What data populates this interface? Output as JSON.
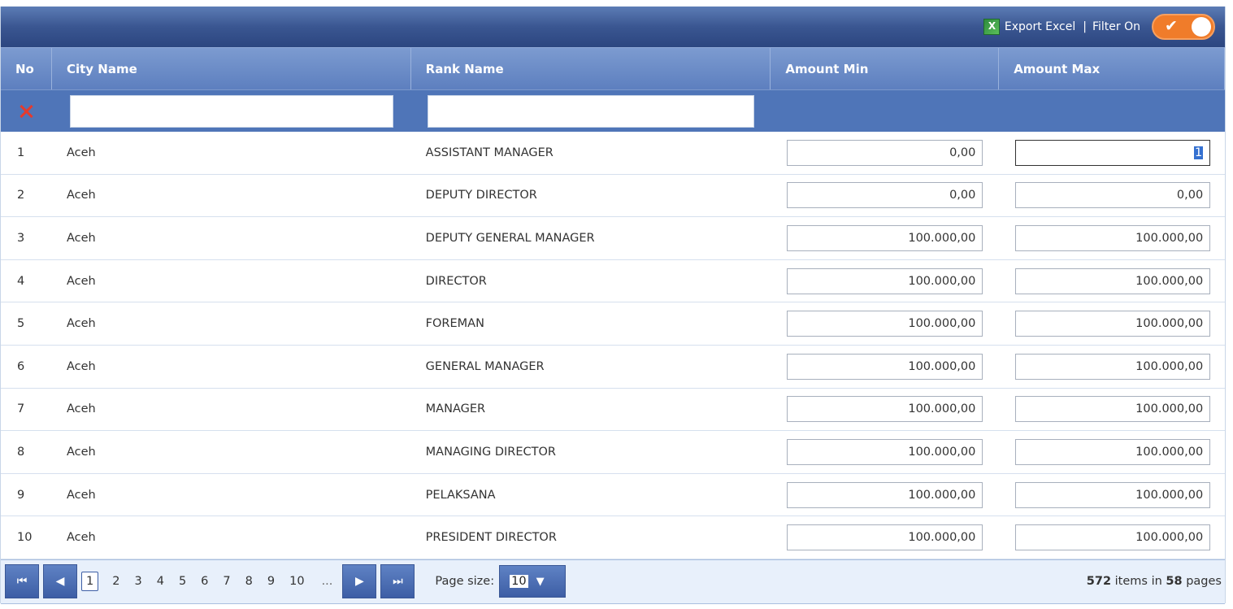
{
  "toolbar": {
    "export_label": "Export Excel",
    "separator": "|",
    "filter_label": "Filter On",
    "filter_on": true,
    "toggle_color": "#f07c2a"
  },
  "columns": [
    "No",
    "City Name",
    "Rank Name",
    "Amount Min",
    "Amount Max"
  ],
  "filters": {
    "city_value": "",
    "rank_value": ""
  },
  "rows": [
    {
      "no": "1",
      "city": "Aceh",
      "rank": "ASSISTANT MANAGER",
      "min": "0,00",
      "max": "1"
    },
    {
      "no": "2",
      "city": "Aceh",
      "rank": "DEPUTY DIRECTOR",
      "min": "0,00",
      "max": "0,00"
    },
    {
      "no": "3",
      "city": "Aceh",
      "rank": "DEPUTY GENERAL MANAGER",
      "min": "100.000,00",
      "max": "100.000,00"
    },
    {
      "no": "4",
      "city": "Aceh",
      "rank": "DIRECTOR",
      "min": "100.000,00",
      "max": "100.000,00"
    },
    {
      "no": "5",
      "city": "Aceh",
      "rank": "FOREMAN",
      "min": "100.000,00",
      "max": "100.000,00"
    },
    {
      "no": "6",
      "city": "Aceh",
      "rank": "GENERAL MANAGER",
      "min": "100.000,00",
      "max": "100.000,00"
    },
    {
      "no": "7",
      "city": "Aceh",
      "rank": "MANAGER",
      "min": "100.000,00",
      "max": "100.000,00"
    },
    {
      "no": "8",
      "city": "Aceh",
      "rank": "MANAGING DIRECTOR",
      "min": "100.000,00",
      "max": "100.000,00"
    },
    {
      "no": "9",
      "city": "Aceh",
      "rank": "PELAKSANA",
      "min": "100.000,00",
      "max": "100.000,00"
    },
    {
      "no": "10",
      "city": "Aceh",
      "rank": "PRESIDENT DIRECTOR",
      "min": "100.000,00",
      "max": "100.000,00"
    }
  ],
  "pager": {
    "pages": [
      "1",
      "2",
      "3",
      "4",
      "5",
      "6",
      "7",
      "8",
      "9",
      "10"
    ],
    "current": "1",
    "ellipsis": "...",
    "page_size_label": "Page size:",
    "page_size": "10",
    "total_items": "572",
    "items_text": "items in",
    "total_pages": "58",
    "pages_text": "pages"
  },
  "colors": {
    "header": "#5d7fbf",
    "toolbar": "#3a5691",
    "filter_row": "#4f75b8"
  }
}
